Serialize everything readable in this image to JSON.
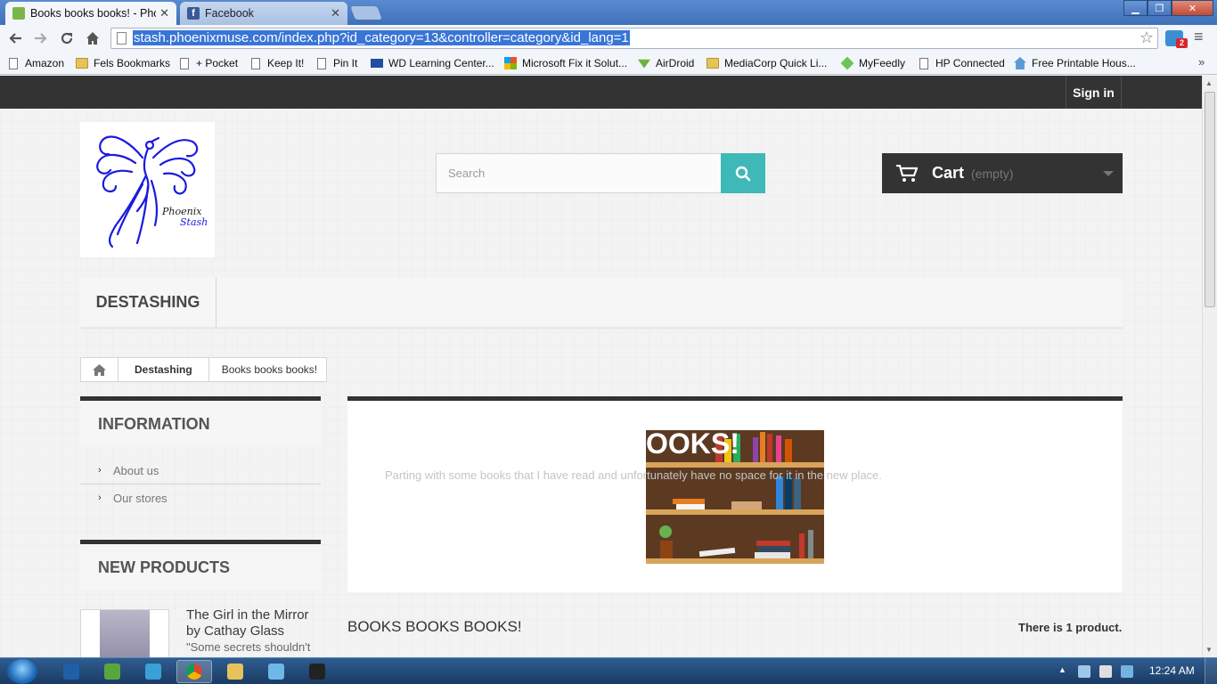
{
  "browser": {
    "tabs": [
      {
        "title": "Books books books! - Pho",
        "active": true
      },
      {
        "title": "Facebook",
        "active": false
      }
    ],
    "url": "stash.phoenixmuse.com/index.php?id_category=13&controller=category&id_lang=1",
    "extension_badge": "2",
    "bookmarks": [
      {
        "label": "Amazon",
        "icon": "page"
      },
      {
        "label": "Fels Bookmarks",
        "icon": "folder"
      },
      {
        "label": "+ Pocket",
        "icon": "page"
      },
      {
        "label": "Keep It!",
        "icon": "page"
      },
      {
        "label": "Pin It",
        "icon": "page"
      },
      {
        "label": "WD Learning Center...",
        "icon": "wd"
      },
      {
        "label": "Microsoft Fix it Solut...",
        "icon": "ms"
      },
      {
        "label": "AirDroid",
        "icon": "airdroid"
      },
      {
        "label": "MediaCorp Quick Li...",
        "icon": "folder"
      },
      {
        "label": "MyFeedly",
        "icon": "feedly"
      },
      {
        "label": "HP Connected",
        "icon": "page"
      },
      {
        "label": "Free Printable Hous...",
        "icon": "house"
      }
    ]
  },
  "site": {
    "signin_label": "Sign in",
    "logo_text_1": "Phoenix",
    "logo_text_2": "Stash",
    "search_placeholder": "Search",
    "cart": {
      "label": "Cart",
      "quantity": "(empty)"
    },
    "menu": {
      "item": "DESTASHING"
    },
    "breadcrumb": {
      "category": "Destashing",
      "current": "Books books books!"
    },
    "sidebar": {
      "info_title": "INFORMATION",
      "info_links": [
        "About us",
        "Our stores"
      ],
      "new_title": "NEW PRODUCTS",
      "product_name": "The Girl in the Mirror by Cathay Glass",
      "product_desc": "\"Some secrets shouldn't"
    },
    "category": {
      "image_text": "OOKS!",
      "description": "Parting with some books that I have read and unfortunately have no space for it in the new place.",
      "heading": "BOOKS BOOKS BOOKS!",
      "count_text": "There is 1 product."
    }
  },
  "taskbar": {
    "clock": "12:24 AM"
  },
  "colors": {
    "accent_teal": "#3fb8b8",
    "dark": "#333333",
    "chrome_blue": "#3f70b9"
  }
}
